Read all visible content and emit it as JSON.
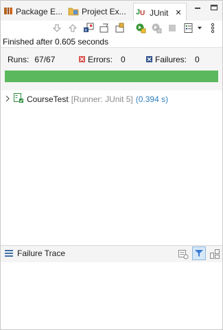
{
  "tabs": [
    {
      "label": "Package E...",
      "icon": "package-explorer-icon"
    },
    {
      "label": "Project Ex...",
      "icon": "project-explorer-icon"
    },
    {
      "label": "JUnit",
      "icon": "junit-icon",
      "active": true
    }
  ],
  "status_text": "Finished after 0.605 seconds",
  "summary": {
    "runs_label": "Runs:",
    "runs_value": "67/67",
    "errors_label": "Errors:",
    "errors_value": "0",
    "failures_label": "Failures:",
    "failures_value": "0",
    "progress": 1.0,
    "progress_color": "#5cb85c"
  },
  "tree": {
    "name": "CourseTest",
    "runner": "[Runner: JUnit 5]",
    "time": "(0.394 s)"
  },
  "failure_trace": {
    "title": "Failure Trace"
  }
}
